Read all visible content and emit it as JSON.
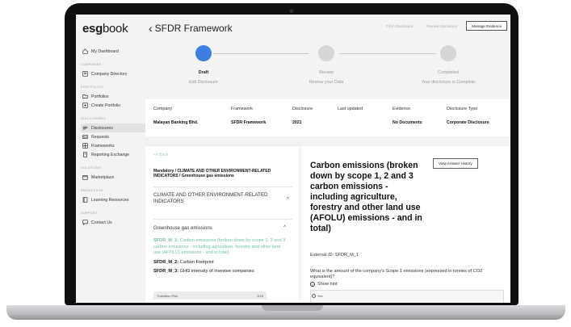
{
  "app": {
    "logo_bold": "esg",
    "logo_light": "book"
  },
  "sidebar": {
    "dashboard": "My Dashboard",
    "sec_companies": "COMPANIES",
    "company_directory": "Company Directory",
    "sec_portfolios": "PORTFOLIOS",
    "portfolios": "Portfolios",
    "create_portfolio": "Create Portfolio",
    "sec_disclosures": "DISCLOSURES",
    "disclosures": "Disclosures",
    "requests": "Requests",
    "frameworks": "Frameworks",
    "reporting_exchange": "Reporting Exchange",
    "sec_solutions": "SOLUTIONS",
    "marketplace": "Marketplace",
    "sec_knowledge": "KNOWLEDGE",
    "learning_resources": "Learning Resources",
    "sec_support": "SUPPORT",
    "contact_us": "Contact Us"
  },
  "header": {
    "title": "SFDR Framework",
    "btn_fill": "Fill in Disclosure",
    "btn_review": "Review Disclosure",
    "btn_manage": "Manage Evidence"
  },
  "steps": [
    {
      "name": "Draft",
      "sub": "Edit Disclosure"
    },
    {
      "name": "Review",
      "sub": "Review your Data"
    },
    {
      "name": "Completed",
      "sub": "Your disclosure is Complete"
    }
  ],
  "details": {
    "h_company": "Company",
    "v_company": "Malayan Banking Bhd.",
    "h_framework": "Framework",
    "v_framework": "SFDR Framework",
    "h_disclosure": "Disclosure",
    "v_disclosure": "2021",
    "h_updated": "Last updated",
    "v_updated": "",
    "h_evidence": "Evidence",
    "v_evidence": "No Documents",
    "h_type": "Disclosure Type",
    "v_type": "Corporate Disclosure"
  },
  "left": {
    "back": "<< Back",
    "crumb": "Mandatory / CLIMATE AND OTHER ENVIRONMENT-RELATED INDICATORS / Greenhouse gas emissions",
    "section": "CLIMATE AND OTHER ENVIRONMENT-RELATED INDICATORS",
    "subsection": "Greenhouse gas emissions",
    "items": [
      {
        "code": "SFDR_M_1:",
        "text": " Carbon emissions (broken down by scope 1, 2 and 3 carbon emissions - including agriculture, forestry and other land use (AFOLU) emissions - and in total)"
      },
      {
        "code": "SFDR_M_2:",
        "text": " Carbon Footprint"
      },
      {
        "code": "SFDR_M_3:",
        "text": " GHG intensity of investee companies"
      }
    ],
    "transition": "Transition Plan",
    "transition_count": "0/18"
  },
  "question": {
    "title": "Carbon emissions (broken down by scope 1, 2 and 3 carbon emissions - including agriculture, forestry and other land use (AFOLU) emissions - and in total)",
    "history_btn": "View Answer History",
    "external_id": "External ID: SFDR_M_1",
    "text": "What is the amount of the company's Scope 1 emissions (expressed in tonnes of CO2 equivalent)?",
    "hint": "Show hint",
    "option_yes": "Yes"
  }
}
